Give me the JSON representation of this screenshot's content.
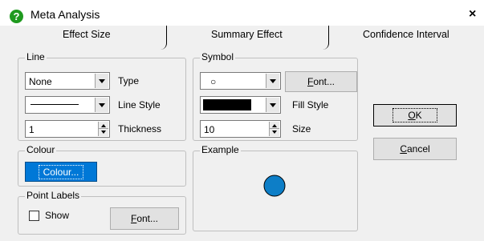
{
  "window": {
    "title": "Meta Analysis",
    "close_glyph": "×",
    "icon": "help-question-icon"
  },
  "tabs": [
    {
      "label": "Effect Size",
      "selected": true
    },
    {
      "label": "Summary Effect",
      "selected": false
    },
    {
      "label": "Confidence Interval",
      "selected": false
    }
  ],
  "line_group": {
    "title": "Line",
    "type_value": "None",
    "type_label": "Type",
    "line_style_label": "Line Style",
    "thickness_value": "1",
    "thickness_label": "Thickness"
  },
  "symbol_group": {
    "title": "Symbol",
    "symbol_value": "○",
    "font_button_mnemonic": "F",
    "font_button_rest": "ont...",
    "fill_style_label": "Fill Style",
    "fill_color": "#000000",
    "size_value": "10",
    "size_label": "Size"
  },
  "colour_group": {
    "title": "Colour",
    "button_label": "Colour...",
    "color": "#0078d7"
  },
  "example_group": {
    "title": "Example",
    "symbol_color": "#0d7ec7"
  },
  "point_labels_group": {
    "title": "Point Labels",
    "show_label": "Show",
    "show_checked": false,
    "font_button_mnemonic": "F",
    "font_button_rest": "ont..."
  },
  "buttons": {
    "ok_mnemonic": "O",
    "ok_rest": "K",
    "cancel_mnemonic": "C",
    "cancel_rest": "ancel"
  }
}
